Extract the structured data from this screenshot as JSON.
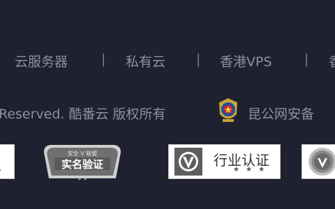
{
  "links": {
    "cloud_server": "云服务器",
    "private_cloud": "私有云",
    "hk_vps": "香港VPS",
    "cut_off": "香",
    "separator": "|"
  },
  "copyright": {
    "text": "Reserved. 酷番云 版权所有",
    "police_record": "昆公网安备"
  },
  "badges": {
    "badge_cut_label": "证",
    "shiming_top": "安全 V 联盟",
    "shiming_label": "实名验证",
    "hangye_label": "行业认证",
    "hangye_stars": "★ ★ ★"
  },
  "colors": {
    "background": "#1f2030",
    "text": "#8f909c"
  }
}
